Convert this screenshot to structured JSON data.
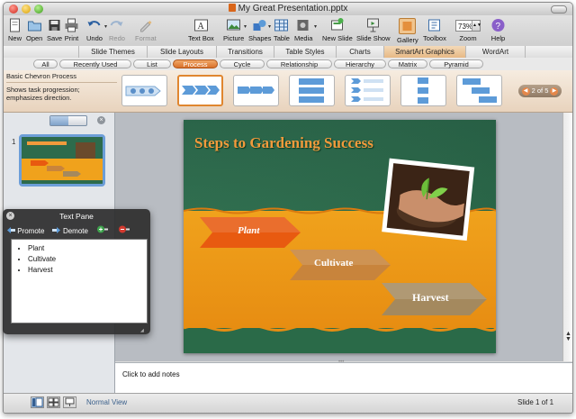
{
  "window": {
    "title": "My Great Presentation.pptx"
  },
  "toolbar": {
    "items": [
      {
        "label": "New",
        "icon": "new-icon"
      },
      {
        "label": "Open",
        "icon": "open-icon"
      },
      {
        "label": "Save",
        "icon": "save-icon"
      },
      {
        "label": "Print",
        "icon": "print-icon"
      },
      {
        "label": "Undo",
        "icon": "undo-icon"
      },
      {
        "label": "Redo",
        "icon": "redo-icon"
      },
      {
        "label": "Format",
        "icon": "format-icon"
      },
      {
        "label": "Text Box",
        "icon": "text-box-icon"
      },
      {
        "label": "Picture",
        "icon": "picture-icon"
      },
      {
        "label": "Shapes",
        "icon": "shapes-icon"
      },
      {
        "label": "Table",
        "icon": "table-icon"
      },
      {
        "label": "Media",
        "icon": "media-icon"
      },
      {
        "label": "New Slide",
        "icon": "new-slide-icon"
      },
      {
        "label": "Slide Show",
        "icon": "slide-show-icon"
      },
      {
        "label": "Gallery",
        "icon": "gallery-icon"
      },
      {
        "label": "Toolbox",
        "icon": "toolbox-icon"
      },
      {
        "label": "Zoom",
        "icon": "zoom-icon"
      },
      {
        "label": "Help",
        "icon": "help-icon"
      }
    ],
    "zoom_value": "73%"
  },
  "ribbon": {
    "tabs": [
      "Slide Themes",
      "Slide Layouts",
      "Transitions",
      "Table Styles",
      "Charts",
      "SmartArt Graphics",
      "WordArt"
    ],
    "selected_tab": "SmartArt Graphics",
    "categories": [
      "All",
      "Recently Used",
      "List",
      "Process",
      "Cycle",
      "Relationship",
      "Hierarchy",
      "Matrix",
      "Pyramid"
    ],
    "selected_category": "Process"
  },
  "gallery": {
    "title": "Basic Chevron Process",
    "description": "Shows task progression; emphasizes direction.",
    "page": "2 of 5"
  },
  "slide": {
    "title": "Steps to Gardening Success",
    "steps": [
      "Plant",
      "Cultivate",
      "Harvest"
    ],
    "thumb_number": "1"
  },
  "text_pane": {
    "title": "Text Pane",
    "promote": "Promote",
    "demote": "Demote",
    "items": [
      "Plant",
      "Cultivate",
      "Harvest"
    ]
  },
  "notes": {
    "placeholder": "Click to add notes"
  },
  "status": {
    "view": "Normal View",
    "slide": "Slide 1 of 1"
  },
  "colors": {
    "accent": "#e0862f",
    "chevron1": "#e85a10",
    "chevron2": "#c8843c",
    "chevron3": "#a4895e",
    "title": "#f29a3c"
  }
}
